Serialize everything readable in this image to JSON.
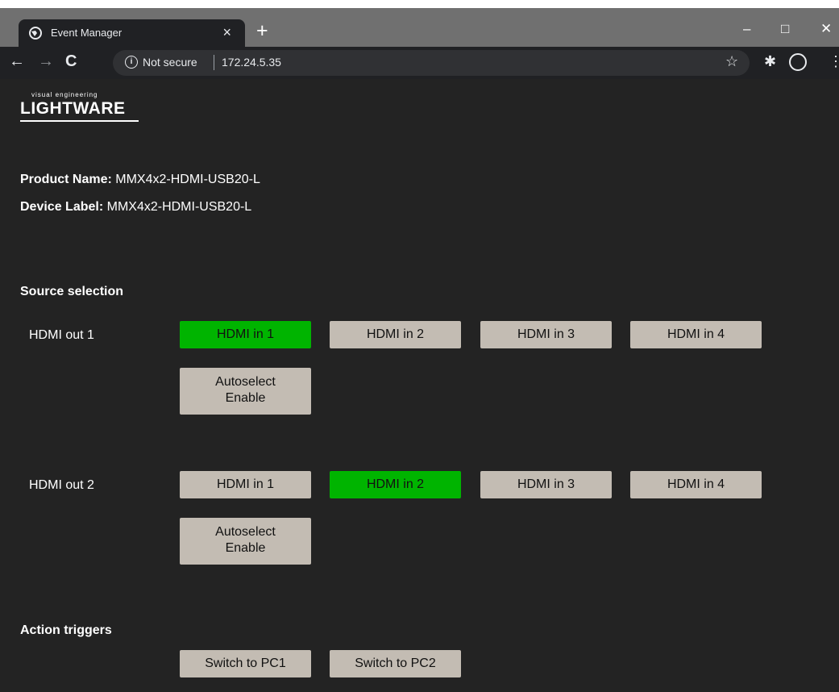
{
  "browser": {
    "tab_title": "Event Manager",
    "tab_close": "×",
    "new_tab": "+",
    "window_controls": {
      "minimize": "–",
      "maximize": "□",
      "close": "✕"
    },
    "nav": {
      "back": "←",
      "forward": "→",
      "reload": "C"
    },
    "omnibox": {
      "info": "i",
      "not_secure": "Not secure",
      "url": "172.24.5.35"
    },
    "icons": {
      "star": "☆",
      "puzzle": "✱",
      "menu": "⋮"
    }
  },
  "page": {
    "logo": {
      "small_text": "visual engineering",
      "main_text": "LIGHTWARE"
    },
    "product": {
      "label": "Product Name:",
      "value": "MMX4x2-HDMI-USB20-L"
    },
    "device": {
      "label": "Device Label:",
      "value": "MMX4x2-HDMI-USB20-L"
    },
    "source_selection": {
      "title": "Source selection",
      "outputs": [
        {
          "label": "HDMI out 1",
          "inputs": [
            "HDMI in 1",
            "HDMI in 2",
            "HDMI in 3",
            "HDMI in 4"
          ],
          "active_index": 0,
          "autoselect": [
            "Autoselect",
            "Enable"
          ]
        },
        {
          "label": "HDMI out 2",
          "inputs": [
            "HDMI in 1",
            "HDMI in 2",
            "HDMI in 3",
            "HDMI in 4"
          ],
          "active_index": 1,
          "autoselect": [
            "Autoselect",
            "Enable"
          ]
        }
      ]
    },
    "action_triggers": {
      "title": "Action triggers",
      "buttons": [
        "Switch to PC1",
        "Switch to PC2"
      ]
    }
  },
  "colors": {
    "active": "#00b400",
    "button": "#c3bcb3",
    "page_bg": "#232323"
  }
}
